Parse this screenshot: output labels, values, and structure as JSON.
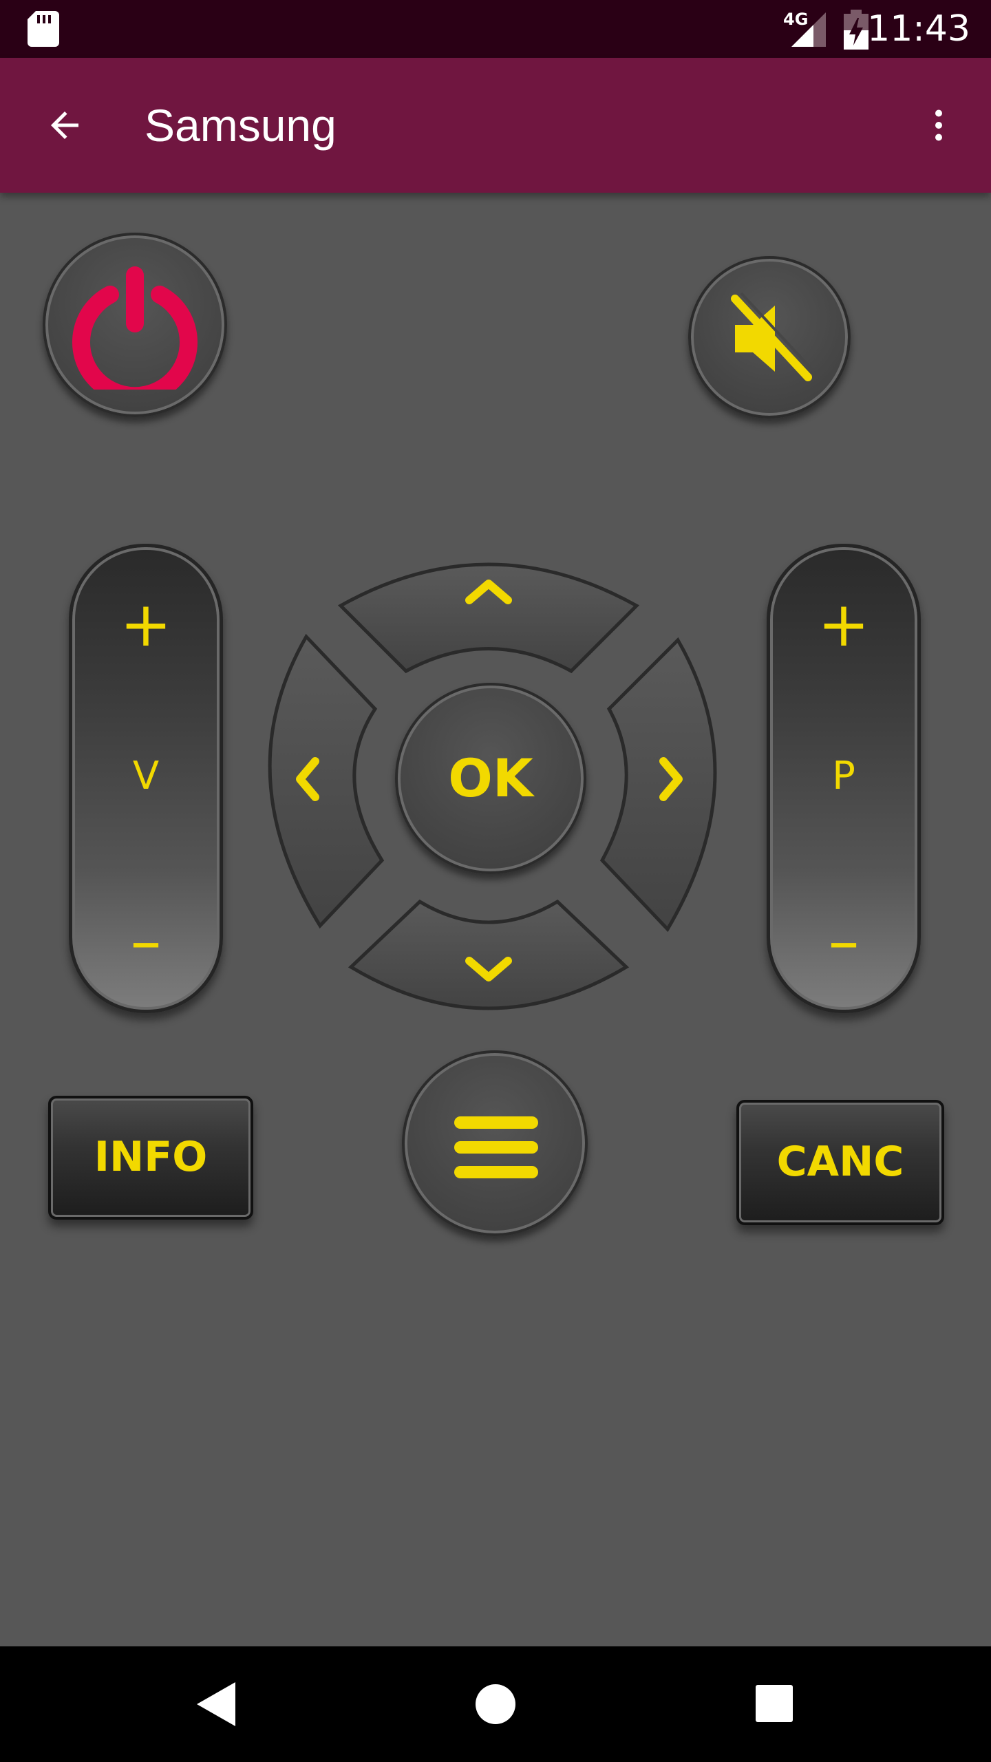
{
  "status_bar": {
    "time": "11:43",
    "network": "4G",
    "icons": [
      "sd-card-icon",
      "signal-icon",
      "battery-charging-icon"
    ]
  },
  "app_bar": {
    "title": "Samsung",
    "back_icon": "arrow-back-icon",
    "menu_icon": "more-vert-icon"
  },
  "remote": {
    "power_icon": "power-icon",
    "mute_icon": "volume-off-icon",
    "volume": {
      "plus": "+",
      "label": "V",
      "minus": "–"
    },
    "channel": {
      "plus": "+",
      "label": "P",
      "minus": "–"
    },
    "ok_label": "OK",
    "menu_icon": "hamburger-menu-icon",
    "info_label": "INFO",
    "canc_label": "CANC"
  },
  "colors": {
    "status_bar": "#2a0015",
    "app_bar": "#701640",
    "background": "#575757",
    "accent_yellow": "#f2d900",
    "power_red": "#e2064b"
  },
  "nav_bar": {
    "icons": [
      "nav-back-icon",
      "nav-home-icon",
      "nav-recents-icon"
    ]
  }
}
